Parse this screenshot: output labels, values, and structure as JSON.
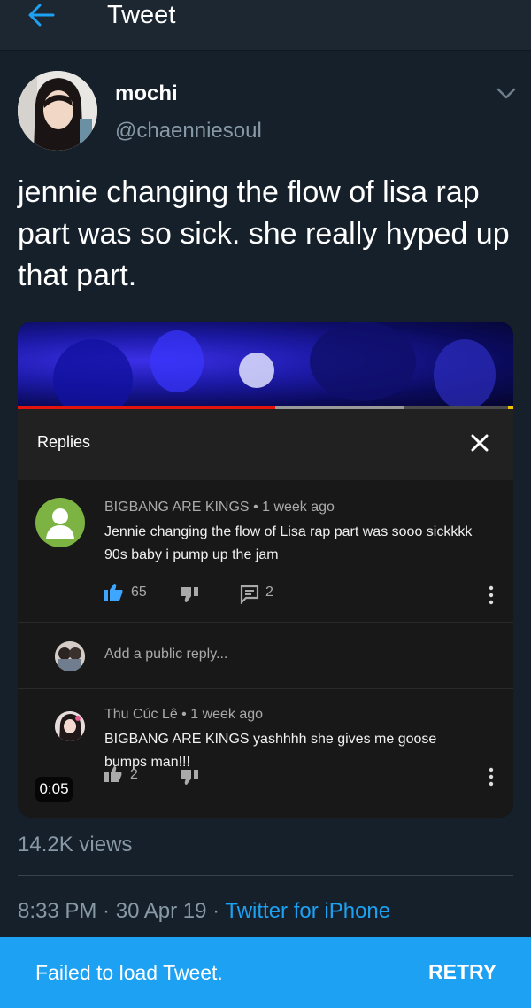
{
  "header": {
    "title": "Tweet",
    "back_icon": "arrow-left-icon"
  },
  "tweet": {
    "display_name": "mochi",
    "handle": "@chaenniesoul",
    "text": "jennie changing the flow of lisa rap part was so sick. she really hyped up that part.",
    "views": "14.2K views",
    "time": "8:33 PM",
    "date": "30 Apr 19",
    "separator": " · ",
    "source": "Twitter for iPhone"
  },
  "video": {
    "duration_badge": "0:05",
    "progress_fraction": 0.52,
    "buffered_fraction": 0.78,
    "replies_panel": {
      "title": "Replies",
      "comment": {
        "author": "BIGBANG ARE KINGS",
        "time": "1 week ago",
        "text": "Jennie changing the flow of Lisa rap part was sooo sickkkk 90s baby i pump up the jam",
        "likes": "65",
        "replies": "2"
      },
      "reply_placeholder": "Add a public reply...",
      "reply": {
        "author": "Thu Cúc Lê",
        "time": "1 week ago",
        "text": "BIGBANG ARE KINGS yashhhh she gives me goose bumps man!!!",
        "likes": "2"
      }
    }
  },
  "snackbar": {
    "message": "Failed to load Tweet.",
    "action": "RETRY"
  },
  "colors": {
    "background": "#15202b",
    "accent": "#1da1f2",
    "muted": "#8899a6",
    "youtube_like": "#3ea6ff",
    "progress": "#e1140e"
  }
}
